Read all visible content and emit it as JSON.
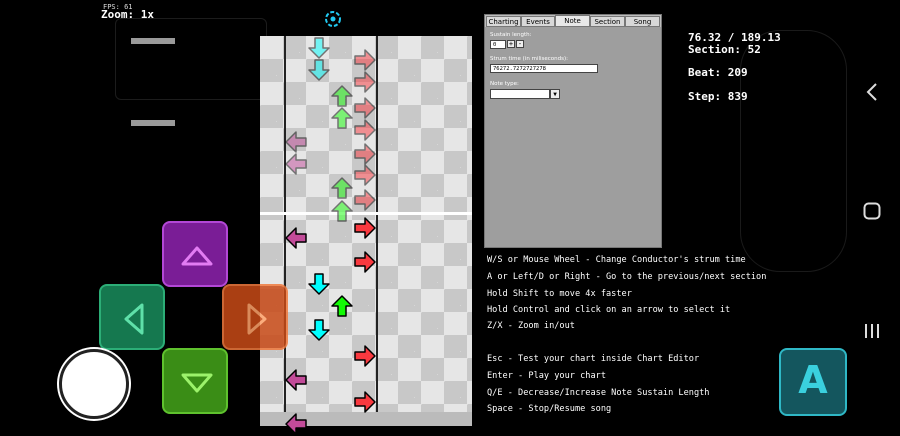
{
  "debug": {
    "fps": "FPS: 61",
    "zoom": "Zoom: 1x"
  },
  "stats": {
    "time": "76.32 / 189.13",
    "section": "Section: 52",
    "beat": "Beat: 209",
    "step": "Step: 839"
  },
  "panel": {
    "tabs": [
      "Charting",
      "Events",
      "Note",
      "Section",
      "Song"
    ],
    "active_tab": "Note",
    "sustain_label": "Sustain length:",
    "sustain_value": "0",
    "strum_label": "Strum time (in miliseconds):",
    "strum_value": "76272.7272727278",
    "note_type_label": "Note type:",
    "note_type_value": ""
  },
  "help": [
    "W/S or Mouse Wheel - Change Conductor's strum time",
    "A or Left/D or Right - Go to the previous/next section",
    "Hold Shift to move 4x faster",
    "Hold Control and click on an arrow to select it",
    "Z/X - Zoom in/out",
    "Esc - Test your chart inside Chart Editor",
    "Enter - Play your chart",
    "Q/E - Decrease/Increase Note Sustain Length",
    "Space - Stop/Resume song"
  ],
  "touch": {
    "a_button": "A"
  },
  "colors": {
    "left": "#c24b99",
    "down": "#00ffff",
    "up": "#12fa05",
    "right": "#f9393f",
    "pad_up": "#8a1ea8",
    "pad_left": "#1a8f5c",
    "pad_right": "#d9531e",
    "pad_down": "#3f9e1a",
    "a_button": "#1b6f78"
  },
  "icons": {
    "back": "chevron-left-icon",
    "home": "square-icon",
    "recents": "three-bars-icon"
  }
}
